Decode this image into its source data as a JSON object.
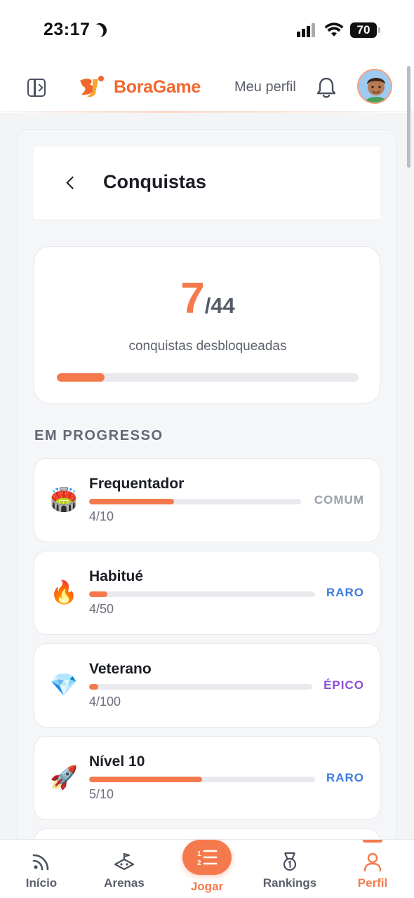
{
  "status_bar": {
    "time": "23:17",
    "battery": "70",
    "moon_icon": "moon-icon",
    "signal_icon": "cellular-signal-icon",
    "wifi_icon": "wifi-icon"
  },
  "header": {
    "brand": "BoraGame",
    "profile_link": "Meu perfil",
    "icons": [
      "sidebar-toggle-icon",
      "bell-icon",
      "avatar"
    ]
  },
  "page": {
    "title": "Conquistas"
  },
  "summary": {
    "unlocked": "7",
    "total": "/44",
    "label": "conquistas desbloqueadas",
    "progress_fraction": 0.159
  },
  "section": {
    "title": "EM PROGRESSO"
  },
  "achievements": [
    {
      "name": "Frequentador",
      "progress": "4/10",
      "fraction": 0.4,
      "rarity": "COMUM",
      "rarity_color": "#9a9ea8",
      "icon": "stadium-icon",
      "glyph": "🏟️"
    },
    {
      "name": "Habitué",
      "progress": "4/50",
      "fraction": 0.08,
      "rarity": "RARO",
      "rarity_color": "#3d7be0",
      "icon": "fire-icon",
      "glyph": "🔥"
    },
    {
      "name": "Veterano",
      "progress": "4/100",
      "fraction": 0.04,
      "rarity": "ÉPICO",
      "rarity_color": "#8a4fd6",
      "icon": "gem-icon",
      "glyph": "💎"
    },
    {
      "name": "Nível 10",
      "progress": "5/10",
      "fraction": 0.5,
      "rarity": "RARO",
      "rarity_color": "#3d7be0",
      "icon": "rocket-icon",
      "glyph": "🚀"
    }
  ],
  "bottom_nav": {
    "items": [
      {
        "label": "Início",
        "icon": "home-feed-icon"
      },
      {
        "label": "Arenas",
        "icon": "arena-icon"
      },
      {
        "label": "Jogar",
        "icon": "play-list-icon"
      },
      {
        "label": "Rankings",
        "icon": "medal-icon"
      },
      {
        "label": "Perfil",
        "icon": "user-icon"
      }
    ],
    "active": "Perfil"
  },
  "colors": {
    "accent": "#f47a4d",
    "brand": "#f2672e",
    "text": "#1a1d24",
    "muted": "#5e6370"
  }
}
